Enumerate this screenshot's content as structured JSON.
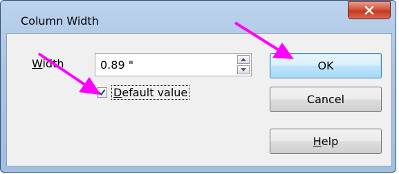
{
  "window": {
    "title": "Column Width"
  },
  "form": {
    "width_label_first": "W",
    "width_label_rest": "idth",
    "width_value": "0.89 \"",
    "default_value_label_first": "D",
    "default_value_label_rest": "efault value",
    "default_value_checked": true
  },
  "buttons": {
    "ok": "OK",
    "cancel": "Cancel",
    "help_first": "H",
    "help_rest": "elp"
  },
  "annotations": {
    "arrow_color": "#ff00ff"
  },
  "icons": {
    "close": "close-x-icon",
    "spin_up": "chevron-up-icon",
    "spin_down": "chevron-down-icon",
    "check": "checkmark-icon"
  }
}
